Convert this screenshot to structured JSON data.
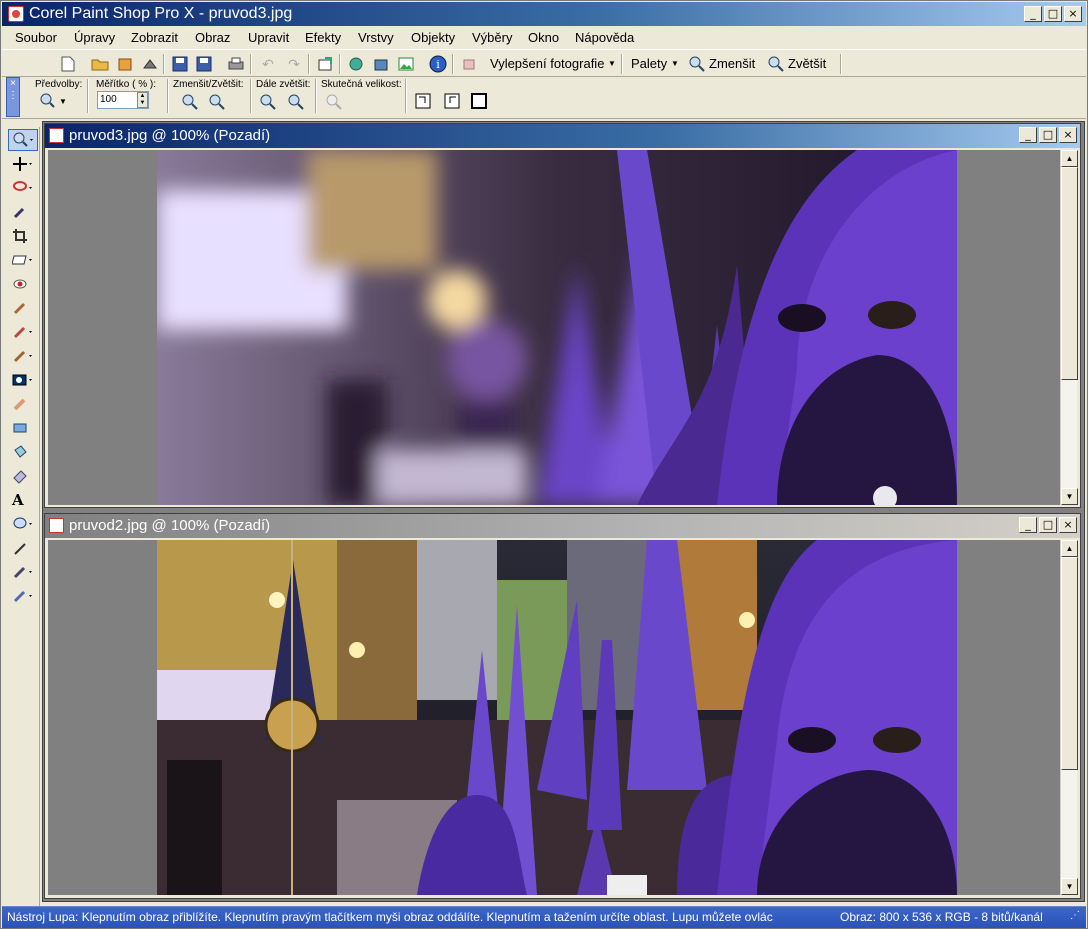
{
  "window": {
    "title": "Corel Paint Shop Pro X - pruvod3.jpg",
    "min": "_",
    "max": "□",
    "close": "×"
  },
  "menu": [
    {
      "label": "Soubor"
    },
    {
      "label": "Úpravy"
    },
    {
      "label": "Zobrazit"
    },
    {
      "label": "Obraz"
    },
    {
      "label": "Upravit"
    },
    {
      "label": "Efekty"
    },
    {
      "label": "Vrstvy"
    },
    {
      "label": "Objekty"
    },
    {
      "label": "Výběry"
    },
    {
      "label": "Okno"
    },
    {
      "label": "Nápověda"
    }
  ],
  "toolbar": {
    "enhance": "Vylepšení fotografie",
    "palettes": "Palety",
    "zoom_out": "Zmenšit",
    "zoom_in": "Zvětšit"
  },
  "options": {
    "presets_label": "Předvolby:",
    "scale_label": "Měřítko ( % ):",
    "scale_value": "100",
    "zoom_label": "Zmenšit/Zvětšit:",
    "more_zoom_label": "Dále zvětšit:",
    "actual_size_label": "Skutečná velikost:"
  },
  "documents": [
    {
      "title": "pruvod3.jpg @ 100% (Pozadí)",
      "active": true,
      "min": "_",
      "max": "□",
      "close": "×"
    },
    {
      "title": "pruvod2.jpg @ 100% (Pozadí)",
      "active": false,
      "min": "_",
      "max": "□",
      "close": "×"
    }
  ],
  "statusbar": {
    "hint": "Nástroj Lupa: Klepnutím obraz přiblížíte. Klepnutím pravým tlačítkem myši obraz oddálíte. Klepnutím a tažením určíte oblast. Lupu můžete ovlác",
    "info": "Obraz:  800 x 536 x RGB - 8 bitů/kanál"
  },
  "colors": {
    "title_active": "#0a246a",
    "status_bg": "#2a52b8",
    "robe": "#5b2fa0"
  }
}
